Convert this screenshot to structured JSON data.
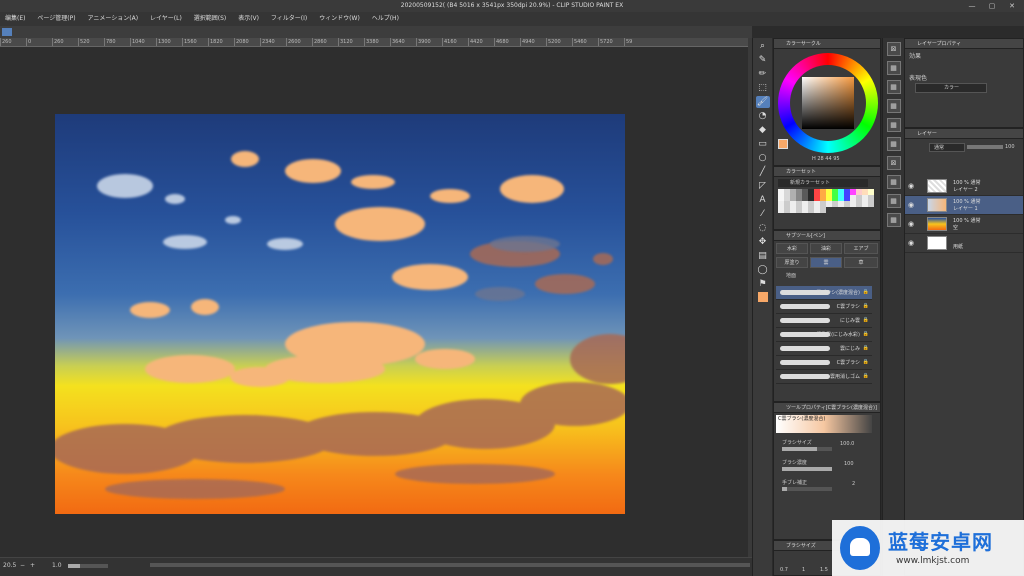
{
  "title_bar": {
    "title": "20200509152(  (B4 5016 x 3541px 350dpi 20.9%)  - CLIP STUDIO PAINT EX",
    "min": "—",
    "max": "▢",
    "close": "✕"
  },
  "menu": [
    "编集(E)",
    "ページ管理(P)",
    "アニメーション(A)",
    "レイヤー(L)",
    "選択範囲(S)",
    "表示(V)",
    "フィルター(I)",
    "ウィンドウ(W)",
    "ヘルプ(H)"
  ],
  "ruler_ticks": [
    "260",
    "0",
    "260",
    "520",
    "780",
    "1040",
    "1300",
    "1560",
    "1820",
    "2080",
    "2340",
    "2600",
    "2860",
    "3120",
    "3380",
    "3640",
    "3900",
    "4160",
    "4420",
    "4680",
    "4940",
    "5200",
    "5460",
    "5720",
    "59"
  ],
  "status": {
    "zoom": "20.5",
    "minus": "−",
    "plus": "+",
    "angle": "1.0"
  },
  "color_wheel": {
    "title": "カラーサークル",
    "current": "#f7a868",
    "readout": "H 28  44  95"
  },
  "color_set": {
    "title": "カラーセット",
    "name": "新規カラーセット"
  },
  "sub_tool": {
    "title": "サブツール[ペン]",
    "tabs": [
      "水彩",
      "油彩",
      "エアブ"
    ],
    "tabs2": [
      "厚塗り",
      "雲",
      "草"
    ],
    "subgroup": "地面"
  },
  "brushes": [
    {
      "label": "C雲ブラシ(濃度混合)",
      "selected": true
    },
    {
      "label": "C雲ブラシ",
      "selected": false
    },
    {
      "label": "にじみ雲",
      "selected": false
    },
    {
      "label": "積乱雲(にじみ水彩)",
      "selected": false
    },
    {
      "label": "雲にじみ",
      "selected": false
    },
    {
      "label": "C雲ブラシ",
      "selected": false
    },
    {
      "label": "雲用消しゴム",
      "selected": false
    }
  ],
  "tool_property": {
    "title": "ツールプロパティ[C雲ブラシ(濃度混合)]",
    "brush_name": "C雲ブラシ(濃度混合)",
    "brush_size_label": "ブラシサイズ",
    "brush_size": "100.0",
    "brush_size_level": 0.7,
    "density_label": "ブラシ濃度",
    "density": "100",
    "density_level": 1.0,
    "stabilization_label": "手ブレ補正",
    "stabilization": "2"
  },
  "brush_size_panel": {
    "title": "ブラシサイズ",
    "values": [
      "0.7",
      "1",
      "1.5"
    ]
  },
  "effect_panel": {
    "title": "レイヤープロパティ",
    "effect_label": "効果",
    "expression_label": "表現色",
    "expression_value": "カラー"
  },
  "layer_panel": {
    "title": "レイヤー",
    "blend_mode": "通常",
    "opacity": "100",
    "layers": [
      {
        "line1": "100 % 通常",
        "line2": "レイヤー 2",
        "selected": false
      },
      {
        "line1": "100 % 通常",
        "line2": "レイヤー 1",
        "selected": true
      },
      {
        "line1": "100 % 通常",
        "line2": "空",
        "selected": false
      },
      {
        "line1": "",
        "line2": "用紙",
        "selected": false
      }
    ]
  },
  "watermark": {
    "name": "蓝莓安卓网",
    "url": "www.lmkjst.com"
  },
  "colors": {
    "accent": "#4a5f86",
    "sky_top": "#1e3b7a",
    "sky_bottom": "#f26a12"
  }
}
